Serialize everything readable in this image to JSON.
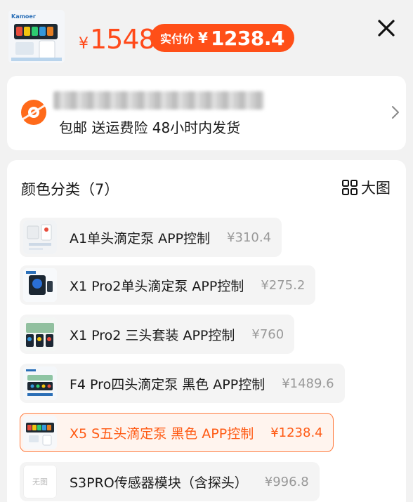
{
  "header": {
    "price_symbol": "¥",
    "price_value": "1548",
    "paid_label": "实付价",
    "paid_symbol": "¥",
    "paid_value": "1238.4",
    "thumb_brand": "Kamoer"
  },
  "shipping": {
    "features": "包邮 送运费险 48小时内发货"
  },
  "colors": {
    "title": "颜色分类（7）",
    "big_image_label": "大图",
    "options": [
      {
        "name": "A1单头滴定泵 APP控制",
        "price": "¥310.4",
        "selected": false
      },
      {
        "name": "X1 Pro2单头滴定泵 APP控制",
        "price": "¥275.2",
        "selected": false
      },
      {
        "name": "X1 Pro2 三头套装 APP控制",
        "price": "¥760",
        "selected": false
      },
      {
        "name": "F4 Pro四头滴定泵 黑色 APP控制",
        "price": "¥1489.6",
        "selected": false
      },
      {
        "name": "X5 S五头滴定泵 黑色 APP控制",
        "price": "¥1238.4",
        "selected": true
      },
      {
        "name": "S3PRO传感器模块（含探头）",
        "price": "¥996.8",
        "selected": false,
        "thumb_text": "无图"
      }
    ]
  },
  "theme": {
    "accent": "#ff4f18",
    "selected_border": "#ff7a3d"
  }
}
